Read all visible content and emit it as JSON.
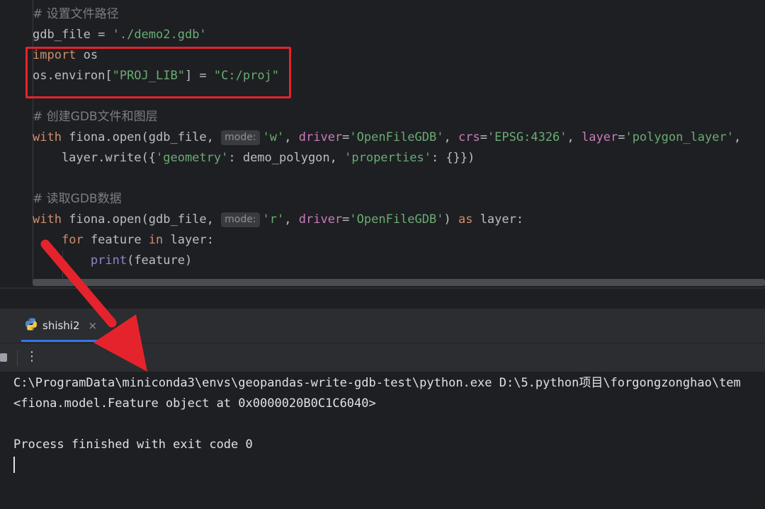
{
  "editor": {
    "comment_path": "# 设置文件路径",
    "gdb_var": "gdb_file",
    "eq": " = ",
    "gdb_value": "'./demo2.gdb'",
    "import_kw": "import",
    "import_mod": " os",
    "environ_prefix": "os.environ[",
    "proj_key": "\"PROJ_LIB\"",
    "environ_mid": "] = ",
    "proj_val": "\"C:/proj\"",
    "comment_create": "# 创建GDB文件和图层",
    "with_kw": "with",
    "open_call": " fiona.open(gdb_file, ",
    "hint_mode": "mode:",
    "mode_w": "'w'",
    "comma_sp": ", ",
    "driver_param": "driver",
    "eq_sign": "=",
    "driver_val": "'OpenFileGDB'",
    "crs_param": "crs",
    "crs_val": "'EPSG:4326'",
    "layer_param": "layer",
    "layer_val": "'polygon_layer'",
    "trailing_comma": ",",
    "write_prefix": "    layer.write({",
    "geometry_key": "'geometry'",
    "write_mid": ": demo_polygon, ",
    "properties_key": "'properties'",
    "write_end": ": {}})",
    "comment_read": "# 读取GDB数据",
    "mode_r": "'r'",
    "open_end": ") ",
    "as_kw": "as",
    "layer_colon": " layer:",
    "for_indent": "    ",
    "for_kw": "for",
    "feature_word": " feature ",
    "in_kw": "in",
    "for_end": " layer:",
    "print_indent": "        ",
    "print_fn": "print",
    "print_args": "(feature)"
  },
  "run_panel": {
    "tab_label": "shishi2",
    "close_glyph": "×",
    "more_glyph": "⋮"
  },
  "console": {
    "line1": "C:\\ProgramData\\miniconda3\\envs\\geopandas-write-gdb-test\\python.exe D:\\5.python项目\\forgongzonghao\\tem",
    "line2": "<fiona.model.Feature object at 0x0000020B0C1C6040>",
    "line3": "Process finished with exit code 0"
  },
  "colors": {
    "annotation_red": "#e5232c",
    "tab_accent": "#3574f0"
  }
}
